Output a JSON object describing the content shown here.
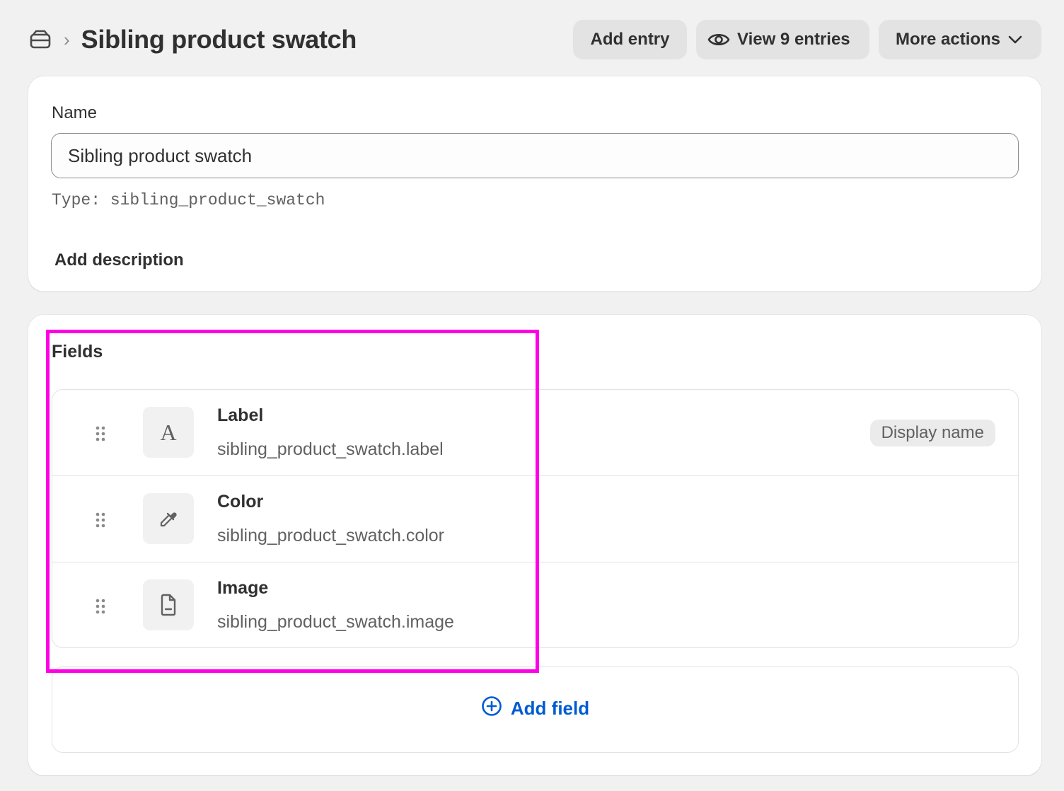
{
  "header": {
    "title": "Sibling product swatch",
    "breadcrumb_icon": "metaobject-icon",
    "breadcrumb_separator": "›",
    "actions": {
      "add_entry": "Add entry",
      "view_entries": "View 9 entries",
      "more_actions": "More actions"
    }
  },
  "definition": {
    "name_label": "Name",
    "name_value": "Sibling product swatch",
    "type_line": "Type: sibling_product_swatch",
    "add_description": "Add description"
  },
  "fields": {
    "title": "Fields",
    "items": [
      {
        "name": "Label",
        "key": "sibling_product_swatch.label",
        "icon": "text-icon",
        "badge": "Display name"
      },
      {
        "name": "Color",
        "key": "sibling_product_swatch.color",
        "icon": "eyedropper-icon"
      },
      {
        "name": "Image",
        "key": "sibling_product_swatch.image",
        "icon": "file-icon"
      }
    ],
    "add_field": "Add field"
  },
  "colors": {
    "background": "#f1f1f1",
    "card": "#ffffff",
    "button": "#e3e3e3",
    "link": "#005bd3",
    "highlight": "#ff00e6"
  }
}
